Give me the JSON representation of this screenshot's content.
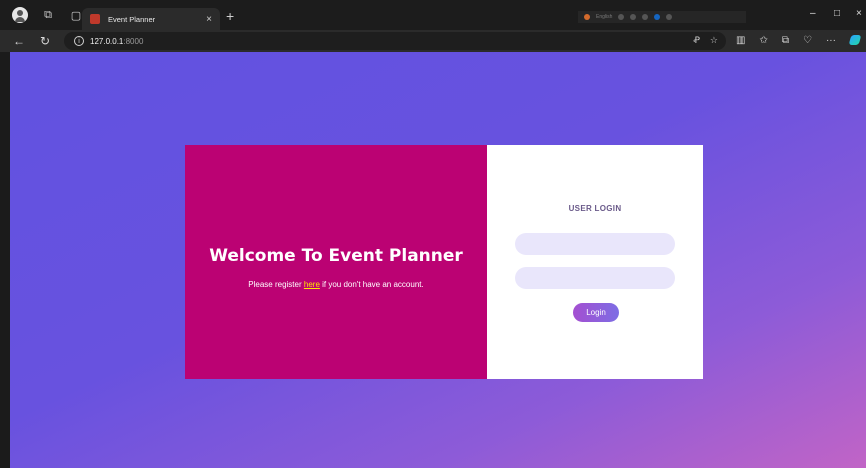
{
  "browser": {
    "tab": {
      "title": "Event Planner",
      "close_glyph": "×",
      "new_tab_glyph": "+"
    },
    "tray_text": "English",
    "window_controls": {
      "minimize": "–",
      "maximize": "□",
      "close": "×"
    },
    "address": {
      "host": "127.0.0.1",
      "port": ":8000"
    },
    "icons": [
      "profile-icon",
      "workspaces-icon",
      "tab-actions-icon",
      "back-icon",
      "refresh-icon",
      "info-icon",
      "read-aloud-icon",
      "favorite-star-icon",
      "split-screen-icon",
      "favorites-icon",
      "collections-icon",
      "browser-essentials-icon",
      "more-icon",
      "copilot-icon"
    ]
  },
  "page": {
    "welcome_heading": "Welcome To Event Planner",
    "register": {
      "prefix": "Please register ",
      "link": "here",
      "suffix": " if you don't have an account."
    },
    "login": {
      "title": "USER LOGIN",
      "username_value": "",
      "username_placeholder": "",
      "password_value": "",
      "password_placeholder": "",
      "button_label": "Login"
    }
  },
  "colors": {
    "left_panel": "#bb0273",
    "link": "#ffe600",
    "input_bg": "#e9e6fb",
    "button_gradient_start": "#a44fd1",
    "button_gradient_end": "#7d6de4",
    "page_gradient_start": "#6152e0",
    "page_gradient_end": "#c164c6"
  }
}
